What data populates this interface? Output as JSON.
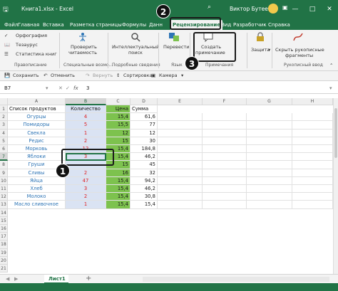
{
  "window": {
    "filename": "Книга1.xlsx - Excel",
    "search_icon": "search-icon",
    "user": "Виктор Бутеев",
    "buttons": [
      "—",
      "□",
      "✕"
    ]
  },
  "menu": {
    "tabs": [
      "Файл",
      "Главная",
      "Вставка",
      "Разметка страницы",
      "Формулы",
      "Данн",
      "Рецензирование",
      "Вид",
      "Разработчик",
      "Справка"
    ],
    "active": "Рецензирование"
  },
  "ribbon": {
    "spelling": "Орфография",
    "thesaurus": "Тезаурус",
    "stats": "Статистика книг",
    "group_proofing": "Правописание",
    "check_access_1": "Проверить",
    "check_access_2": "читаемость",
    "group_access": "Специальные возмо...",
    "smart_lookup_1": "Интеллектуальный",
    "smart_lookup_2": "поиск",
    "group_insights": "Подробные сведения",
    "translate": "Перевести",
    "group_language": "Язык",
    "new_comment_1": "Создать",
    "new_comment_2": "примечание",
    "group_comments": "Примечания",
    "protect": "Защита",
    "hide_ink_1": "Скрыть рукописные",
    "hide_ink_2": "фрагменты",
    "group_ink": "Рукописный ввод"
  },
  "quick_access": {
    "save": "Сохранить",
    "undo": "Отменить",
    "redo": "Вернуть",
    "sort": "Сортировка",
    "camera": "Камера"
  },
  "formula_bar": {
    "name_box": "B7",
    "fx": "fx",
    "value": "3"
  },
  "columns": [
    "A",
    "B",
    "C",
    "D",
    "E",
    "F",
    "G",
    "H"
  ],
  "headers": [
    "Список продуктов",
    "Количество",
    "Цена",
    "Сумма"
  ],
  "rows": [
    [
      "Огурцы",
      "4",
      "15,4",
      "61,6"
    ],
    [
      "Помидоры",
      "5",
      "15,5",
      "77"
    ],
    [
      "Свекла",
      "1",
      "12",
      "12"
    ],
    [
      "Редис",
      "2",
      "15",
      "30"
    ],
    [
      "Морковь",
      "12",
      "15,4",
      "184,8"
    ],
    [
      "Яблоки",
      "3",
      "15,4",
      "46,2"
    ],
    [
      "Груши",
      "",
      "15",
      "45"
    ],
    [
      "Сливы",
      "2",
      "16",
      "32"
    ],
    [
      "Яйца",
      "47",
      "15,4",
      "94,2"
    ],
    [
      "Хлеб",
      "3",
      "15,4",
      "46,2"
    ],
    [
      "Молоко",
      "2",
      "15,4",
      "30,8"
    ],
    [
      "Масло сливочное",
      "1",
      "15,4",
      "15,4"
    ]
  ],
  "row_numbers": [
    "1",
    "2",
    "3",
    "4",
    "5",
    "6",
    "7",
    "8",
    "9",
    "10",
    "11",
    "12",
    "13",
    "14",
    "15",
    "16",
    "17",
    "18",
    "19",
    "20",
    "21"
  ],
  "sheet": {
    "name": "Лист1",
    "add": "+"
  },
  "callouts": [
    "1",
    "2",
    "3"
  ],
  "colors": {
    "excel_green": "#217346",
    "qty_fill": "#dae3f3",
    "price_fill": "#7dc24e",
    "product_text": "#2e75b6",
    "qty_text": "#e02020"
  }
}
